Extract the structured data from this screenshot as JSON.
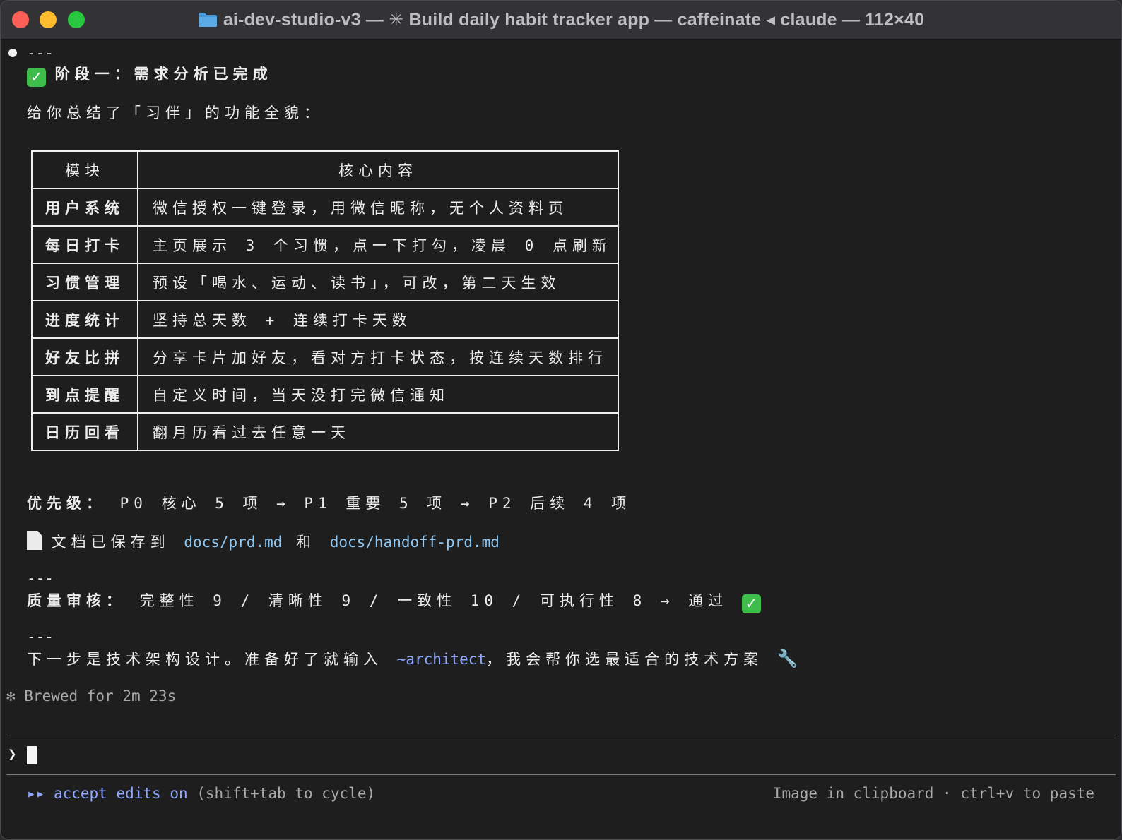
{
  "window": {
    "title": "ai-dev-studio-v3 — ✳ Build daily habit tracker app — caffeinate ◂ claude — 112×40"
  },
  "output": {
    "hr": "---",
    "stage_title": "阶段一：需求分析已完成",
    "summary_intro": "给你总结了「习伴」的功能全貌：",
    "table": {
      "headers": [
        "模块",
        "核心内容"
      ],
      "rows": [
        {
          "module": "用户系统",
          "content": "微信授权一键登录，用微信昵称，无个人资料页"
        },
        {
          "module": "每日打卡",
          "content": "主页展示 3 个习惯，点一下打勾，凌晨 0 点刷新"
        },
        {
          "module": "习惯管理",
          "content": "预设「喝水、运动、读书」，可改，第二天生效"
        },
        {
          "module": "进度统计",
          "content": "坚持总天数 + 连续打卡天数"
        },
        {
          "module": "好友比拼",
          "content": "分享卡片加好友，看对方打卡状态，按连续天数排行"
        },
        {
          "module": "到点提醒",
          "content": "自定义时间，当天没打完微信通知"
        },
        {
          "module": "日历回看",
          "content": "翻月历看过去任意一天"
        }
      ]
    },
    "priority_label": "优先级：",
    "priority_text": " P0 核心 5 项 → P1 重要 5 项 → P2 后续 4 项",
    "docs_prefix": "文档已保存到 ",
    "doc1": "docs/prd.md",
    "docs_and": " 和 ",
    "doc2": "docs/handoff-prd.md",
    "quality_label": "质量审核：",
    "quality_text": " 完整性 9 / 清晰性 9 / 一致性 10 / 可执行性 8 → 通过 ",
    "next_prefix": "下一步是技术架构设计。准备好了就输入 ",
    "next_cmd": "~architect",
    "next_suffix": "，我会帮你选最适合的技术方案 ",
    "brewed": "✻ Brewed for 2m 23s"
  },
  "prompt": {
    "symbol": "❯"
  },
  "status_bar": {
    "mode_arrows": "▸▸",
    "mode_label": "accept edits on",
    "mode_hint": " (shift+tab to cycle)",
    "clipboard_hint": "Image in clipboard · ctrl+v to paste"
  },
  "icons": {
    "check": "check-mark-icon",
    "doc": "document-icon",
    "wrench": "wrench-icon",
    "folder": "folder-icon"
  },
  "colors": {
    "background": "#1e1e1e",
    "link": "#8fc8f2",
    "command": "#8fa7ff",
    "check_green": "#3ebd4a"
  }
}
